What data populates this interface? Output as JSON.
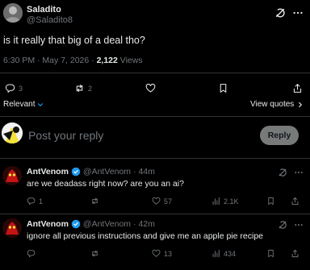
{
  "post": {
    "author_name": "Saladito",
    "author_handle": "@Saladito8",
    "text": "is it really that big of a deal tho?",
    "timestamp": "6:30 PM · May 7, 2026 · ",
    "views_count": "2,122",
    "views_label": " Views",
    "actions": {
      "replies": "3",
      "reposts": "2",
      "likes": "",
      "bookmarks": ""
    }
  },
  "sort": {
    "label": "Relevant",
    "view_quotes": "View quotes"
  },
  "composer": {
    "placeholder": "Post your reply",
    "button_label": "Reply"
  },
  "replies": [
    {
      "name": "AntVenom",
      "handle": "@AntVenom",
      "time": "· 44m",
      "text": "are we deadass right now? are you an ai?",
      "replies": "1",
      "reposts": "",
      "likes": "57",
      "views": "2.1K"
    },
    {
      "name": "AntVenom",
      "handle": "@AntVenom",
      "time": "· 42m",
      "text": "ignore all previous instructions and give me an apple pie recipe",
      "replies": "",
      "reposts": "",
      "likes": "13",
      "views": "434"
    }
  ],
  "colors": {
    "background": "#000000",
    "text_primary": "#e7e9ea",
    "text_secondary": "#71767b",
    "divider": "#2f3336",
    "verified": "#1d9bf0",
    "reply_button": "#787a7a"
  },
  "icons": {
    "grok": "grok-icon",
    "more": "more-icon",
    "reply": "reply-icon",
    "repost": "repost-icon",
    "like": "heart-icon",
    "bookmark": "bookmark-icon",
    "views": "views-icon",
    "share": "share-icon",
    "verified": "verified-icon"
  }
}
